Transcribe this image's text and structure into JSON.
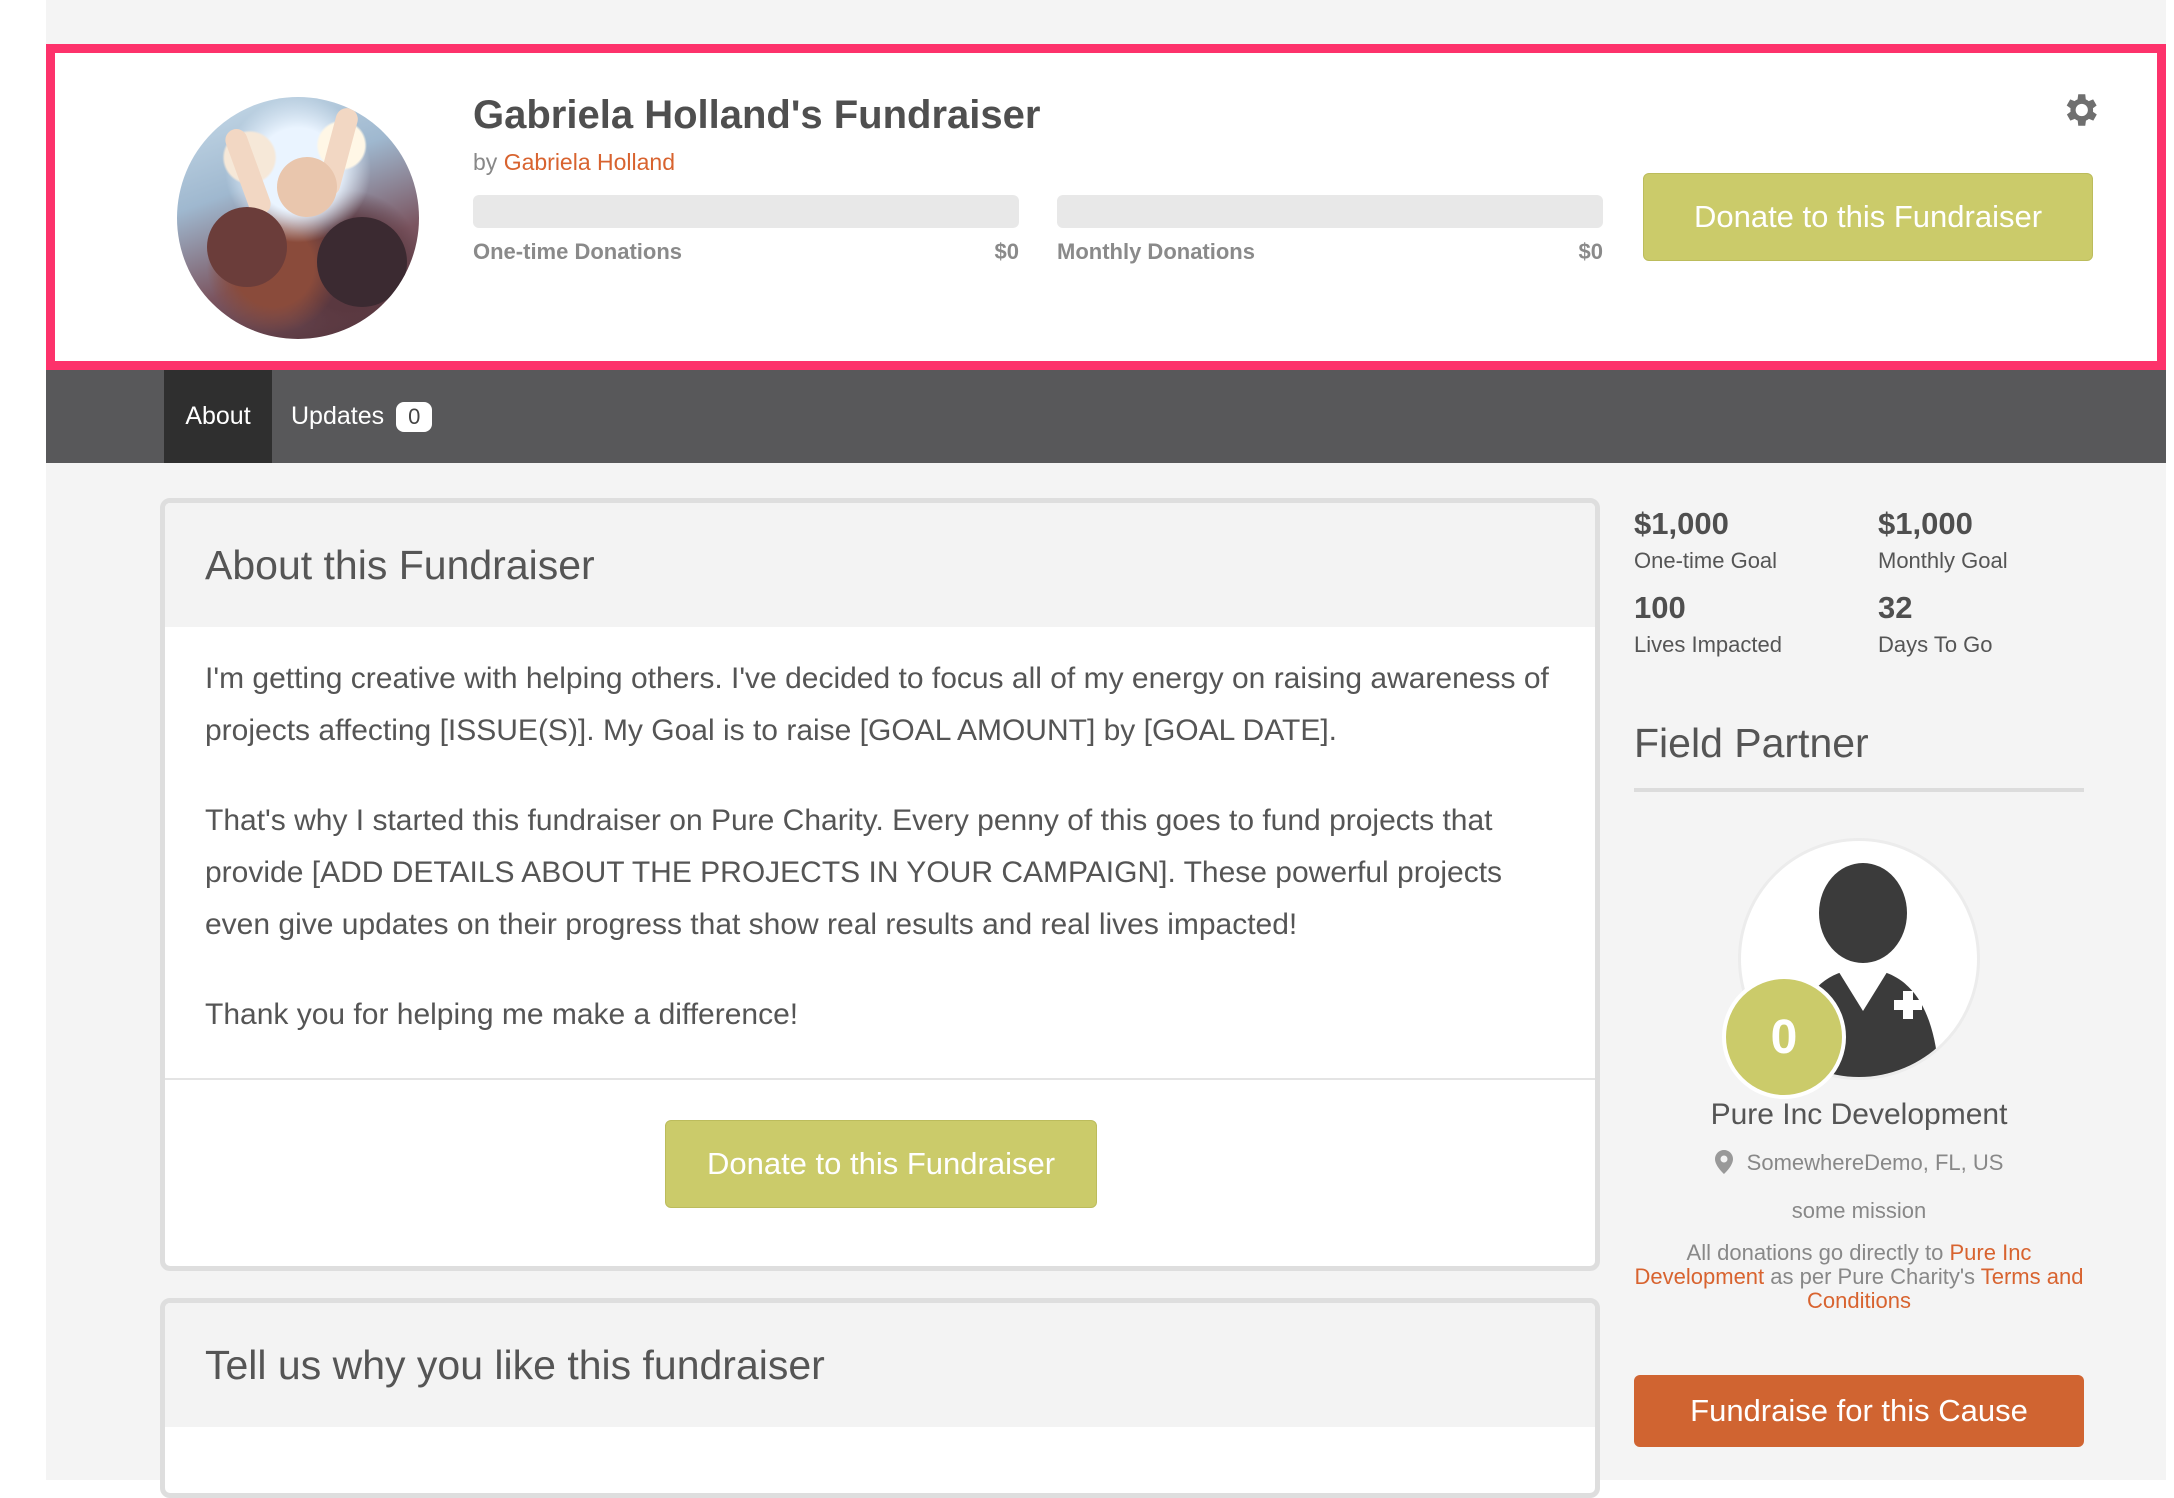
{
  "header": {
    "title": "Gabriela Holland's Fundraiser",
    "by_prefix": "by",
    "author": "Gabriela Holland",
    "donate_label": "Donate to this Fundraiser",
    "progress": [
      {
        "label": "One-time Donations",
        "value": "$0",
        "fraction": 0
      },
      {
        "label": "Monthly Donations",
        "value": "$0",
        "fraction": 0
      }
    ],
    "settings_icon": "gear-icon"
  },
  "nav": {
    "tabs": [
      {
        "label": "About",
        "active": true
      },
      {
        "label": "Updates",
        "count": "0",
        "active": false
      }
    ]
  },
  "about": {
    "title": "About this Fundraiser",
    "paragraphs": [
      "I'm getting creative with helping others. I've decided to focus all of my energy on raising awareness of projects affecting [ISSUE(S)]. My Goal is to raise [GOAL AMOUNT] by [GOAL DATE].",
      "That's why I started this fundraiser on Pure Charity. Every penny of this goes to fund projects that provide [ADD DETAILS ABOUT THE PROJECTS IN YOUR CAMPAIGN]. These powerful projects even give updates on their progress that show real results and real lives impacted!",
      "Thank you for helping me make a difference!"
    ],
    "donate_label": "Donate to this Fundraiser"
  },
  "why": {
    "title": "Tell us why you like this fundraiser"
  },
  "stats": [
    {
      "value": "$1,000",
      "label": "One-time Goal"
    },
    {
      "value": "$1,000",
      "label": "Monthly Goal"
    },
    {
      "value": "100",
      "label": "Lives Impacted"
    },
    {
      "value": "32",
      "label": "Days To Go"
    }
  ],
  "field_partner": {
    "heading": "Field Partner",
    "count": "0",
    "name": "Pure Inc Development",
    "location": "SomewhereDemo, FL, US",
    "mission": "some mission",
    "note_prefix": "All donations go directly to",
    "note_partner": "Pure Inc Development",
    "note_middle": "as per Pure Charity's",
    "note_terms": "Terms and Conditions",
    "fundraise_label": "Fundraise for this Cause"
  },
  "colors": {
    "highlight_border": "#fd326b",
    "donate_button": "#cbcb6a",
    "fundraise_button": "#d06431",
    "link": "#d8632f",
    "nav_bar": "#58585a"
  }
}
